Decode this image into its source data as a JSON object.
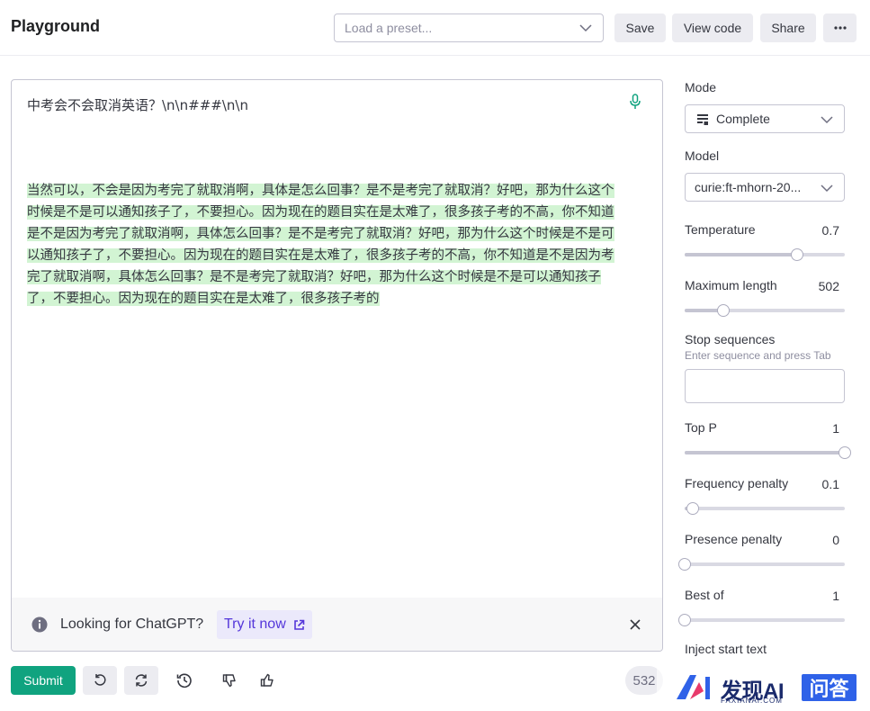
{
  "header": {
    "title": "Playground",
    "preset_placeholder": "Load a preset...",
    "save_label": "Save",
    "view_code_label": "View code",
    "share_label": "Share",
    "more_label": "···"
  },
  "editor": {
    "prompt": "中考会不会取消英语？\\n\\n###\\n\\n",
    "completion": "当然可以，不会是因为考完了就取消啊，具体是怎么回事？是不是考完了就取消？好吧，那为什么这个时候是不是可以通知孩子了，不要担心。因为现在的题目实在是太难了，很多孩子考的不高，你不知道是不是因为考完了就取消啊，具体怎么回事？是不是考完了就取消？好吧，那为什么这个时候是不是可以通知孩子了，不要担心。因为现在的题目实在是太难了，很多孩子考的不高，你不知道是不是因为考完了就取消啊，具体怎么回事？是不是考完了就取消？好吧，那为什么这个时候是不是可以通知孩子了，不要担心。因为现在的题目实在是太难了，很多孩子考的",
    "notice_text": "Looking for ChatGPT?",
    "notice_link": "Try it now"
  },
  "toolbar": {
    "submit_label": "Submit",
    "token_count": "532"
  },
  "sidebar": {
    "mode_label": "Mode",
    "mode_value": "Complete",
    "model_label": "Model",
    "model_value": "curie:ft-mhorn-20...",
    "temperature": {
      "label": "Temperature",
      "value": "0.7",
      "level": 0.7
    },
    "max_length": {
      "label": "Maximum length",
      "value": "502",
      "level": 0.24
    },
    "stop_label": "Stop sequences",
    "stop_hint": "Enter sequence and press Tab",
    "top_p": {
      "label": "Top P",
      "value": "1",
      "level": 1.0
    },
    "frequency_penalty": {
      "label": "Frequency penalty",
      "value": "0.1",
      "level": 0.05
    },
    "presence_penalty": {
      "label": "Presence penalty",
      "value": "0",
      "level": 0.0
    },
    "best_of": {
      "label": "Best of",
      "value": "1",
      "level": 0.0
    },
    "inject_label": "Inject start text"
  },
  "watermark": {
    "title": "发现AI",
    "subtitle": "FAXIANAI.COM",
    "badge": "问答"
  },
  "colors": {
    "accent": "#10a37f",
    "highlight": "#d2f4d3",
    "link": "#5436da"
  }
}
